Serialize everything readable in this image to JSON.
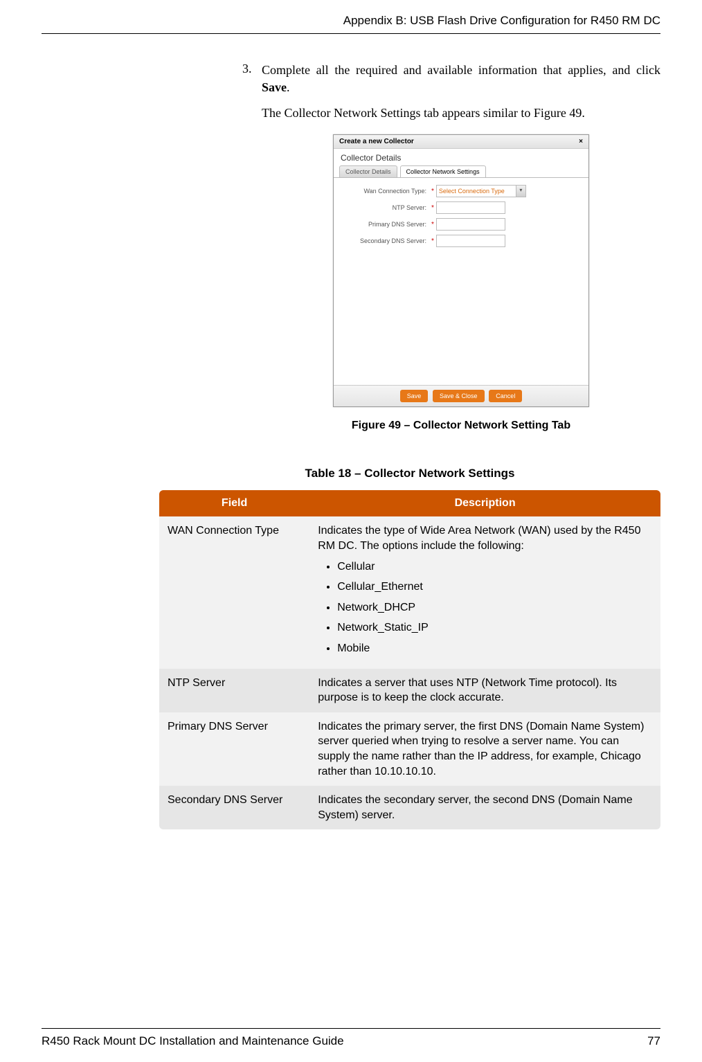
{
  "header": {
    "title": "Appendix B: USB Flash Drive Configuration for R450 RM DC"
  },
  "step": {
    "num": "3.",
    "text_pre": "Complete all the required and available information that applies, and click ",
    "bold": "Save",
    "text_post": "."
  },
  "subtext": "The Collector Network Settings tab appears similar to Figure 49.",
  "dialog": {
    "title": "Create a new Collector",
    "close": "×",
    "subtitle": "Collector Details",
    "tab1": "Collector Details",
    "tab2": "Collector Network Settings",
    "row1": "Wan Connection Type:",
    "row1_sel": "Select Connection Type",
    "row2": "NTP Server:",
    "row3": "Primary DNS Server:",
    "row4": "Secondary DNS Server:",
    "btn_save": "Save",
    "btn_saveclose": "Save & Close",
    "btn_cancel": "Cancel"
  },
  "figcap": "Figure 49  –  Collector Network Setting Tab",
  "tblcap": "Table 18  –  Collector Network Settings",
  "table": {
    "h1": "Field",
    "h2": "Description",
    "r1f": "WAN Connection Type",
    "r1d": "Indicates the type of Wide Area Network (WAN) used by the R450 RM DC. The options include the following:",
    "r1o1": "Cellular",
    "r1o2": "Cellular_Ethernet",
    "r1o3": "Network_DHCP",
    "r1o4": "Network_Static_IP",
    "r1o5": "Mobile",
    "r2f": "NTP Server",
    "r2d": "Indicates a server that uses NTP (Network Time protocol). Its purpose is to keep the clock accurate.",
    "r3f": "Primary DNS Server",
    "r3d": "Indicates the primary server, the first DNS (Domain Name System) server queried when trying to resolve a server name. You can supply the name rather than the IP address, for example, Chicago rather than 10.10.10.10.",
    "r4f": "Secondary DNS Server",
    "r4d": "Indicates the secondary server, the second DNS (Domain Name System) server."
  },
  "footer": {
    "doc": "R450 Rack Mount DC Installation and Maintenance Guide",
    "page": "77"
  }
}
